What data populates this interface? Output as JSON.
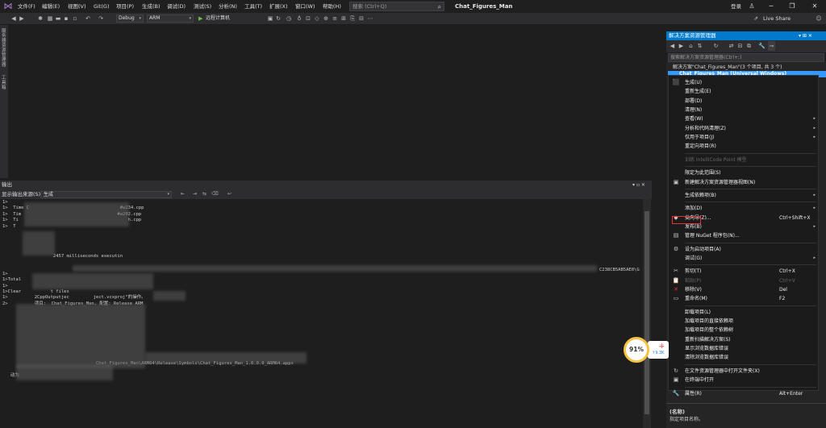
{
  "menu": {
    "items": [
      "文件(F)",
      "编辑(E)",
      "视图(V)",
      "Git(G)",
      "项目(P)",
      "生成(B)",
      "调试(D)",
      "测试(S)",
      "分析(N)",
      "工具(T)",
      "扩展(X)",
      "窗口(W)",
      "帮助(H)"
    ],
    "search_placeholder": "搜索 (Ctrl+Q)",
    "app_title": "Chat_Figures_Man",
    "login": "登录",
    "live_share": "Live Share"
  },
  "toolbar": {
    "config": "Debug",
    "platform": "ARM",
    "run_target": "远程计算机"
  },
  "left_tabs": [
    "服务器资源管理器",
    "工具箱"
  ],
  "output": {
    "title": "输出",
    "source_label": "显示输出来源(S):",
    "source_value": "生成",
    "lines": [
      "1>",
      "1>  Time C                                  #w234.cpp",
      "1>  Tim                                    #w202.cpp",
      "1>  Ti                                         h.cpp",
      "1>  T",
      "",
      "",
      "",
      "",
      "                   2457 milliseconds executin",
      "",
      "",
      "1>",
      "1>Total",
      "1>",
      "1>Clear           t files",
      "1>          2CppOutputjec         ject.vcxproj\"的操作。",
      "2>          项目:  Chat_Figures_Man, 配置: Release ARM",
      "",
      "",
      "",
      "",
      "",
      "",
      "",
      "",
      "",
      "                                   Chat_Figures_Man\\ARM64\\Release\\Symbols\\Chat_Figures_Man_1.0.0.0_ARM64.appx",
      "",
      "   动为"
    ],
    "hash_fragment": "C238CB5AB5AE0\\G"
  },
  "solution_explorer": {
    "title": "解决方案资源管理器",
    "search_placeholder": "搜索解决方案资源管理器(Ctrl+;)",
    "solution_label": "解决方案\"Chat_Figures_Man\"(3 个项目, 共 3 个)",
    "project_label": "Chat_Figures_Man (Universal Windows)"
  },
  "context_menu": {
    "items": [
      {
        "label": "生成(U)",
        "icon": "build-icon",
        "glyph": "⬛"
      },
      {
        "label": "重新生成(E)"
      },
      {
        "label": "部署(D)"
      },
      {
        "label": "清理(N)"
      },
      {
        "label": "查看(W)",
        "sub": true
      },
      {
        "label": "分析和代码清理(Z)",
        "sub": true
      },
      {
        "label": "仅用于项目(J)",
        "sub": true
      },
      {
        "label": "重定向项目(R)"
      },
      {
        "separator": true
      },
      {
        "label": "训练 IntelliCode Point 模型",
        "disabled": true
      },
      {
        "separator": true
      },
      {
        "label": "限定为此范围(S)"
      },
      {
        "label": "新建解决方案资源管理器视图(N)",
        "icon": "new-view-icon",
        "glyph": "▣"
      },
      {
        "separator": true
      },
      {
        "label": "生成依赖项(B)",
        "sub": true
      },
      {
        "separator": true
      },
      {
        "label": "添加(D)",
        "sub": true
      },
      {
        "label": "类向导(Z)...",
        "icon": "class-wizard-icon",
        "glyph": "◆",
        "shortcut": "Ctrl+Shift+X"
      },
      {
        "label": "发布(B)",
        "sub": true
      },
      {
        "label": "管理 NuGet 程序包(N)...",
        "icon": "nuget-icon",
        "glyph": "▤"
      },
      {
        "separator": true
      },
      {
        "label": "设为启动项目(A)",
        "icon": "gear-icon",
        "glyph": "⚙"
      },
      {
        "label": "调试(G)",
        "sub": true
      },
      {
        "separator": true
      },
      {
        "label": "剪切(T)",
        "icon": "scissors-icon",
        "glyph": "✂",
        "shortcut": "Ctrl+X"
      },
      {
        "label": "粘贴(P)",
        "icon": "paste-icon",
        "glyph": "📋",
        "shortcut": "Ctrl+V",
        "disabled": true
      },
      {
        "label": "移除(V)",
        "icon": "remove-icon",
        "glyph": "✕",
        "shortcut": "Del",
        "red": true
      },
      {
        "label": "重命名(M)",
        "icon": "rename-icon",
        "glyph": "▭",
        "shortcut": "F2"
      },
      {
        "separator": true
      },
      {
        "label": "卸载项目(L)"
      },
      {
        "label": "加载项目的直接依赖项"
      },
      {
        "label": "加载项目的整个依赖树"
      },
      {
        "label": "重新扫描解决方案(S)"
      },
      {
        "label": "显示浏览数据库错误"
      },
      {
        "label": "清除浏览数据库错误"
      },
      {
        "separator": true
      },
      {
        "label": "在文件资源管理器中打开文件夹(X)",
        "icon": "refresh-icon",
        "glyph": "↻"
      },
      {
        "label": "在终端中打开",
        "icon": "terminal-icon",
        "glyph": "▣"
      },
      {
        "separator": true
      },
      {
        "label": "属性(R)",
        "icon": "wrench-icon",
        "glyph": "🔧",
        "shortcut": "Alt+Enter"
      }
    ]
  },
  "properties": {
    "name": "(名称)",
    "description": "指定项目名称。"
  },
  "widget": {
    "percent": "91%",
    "speed": "↑9.3K"
  }
}
